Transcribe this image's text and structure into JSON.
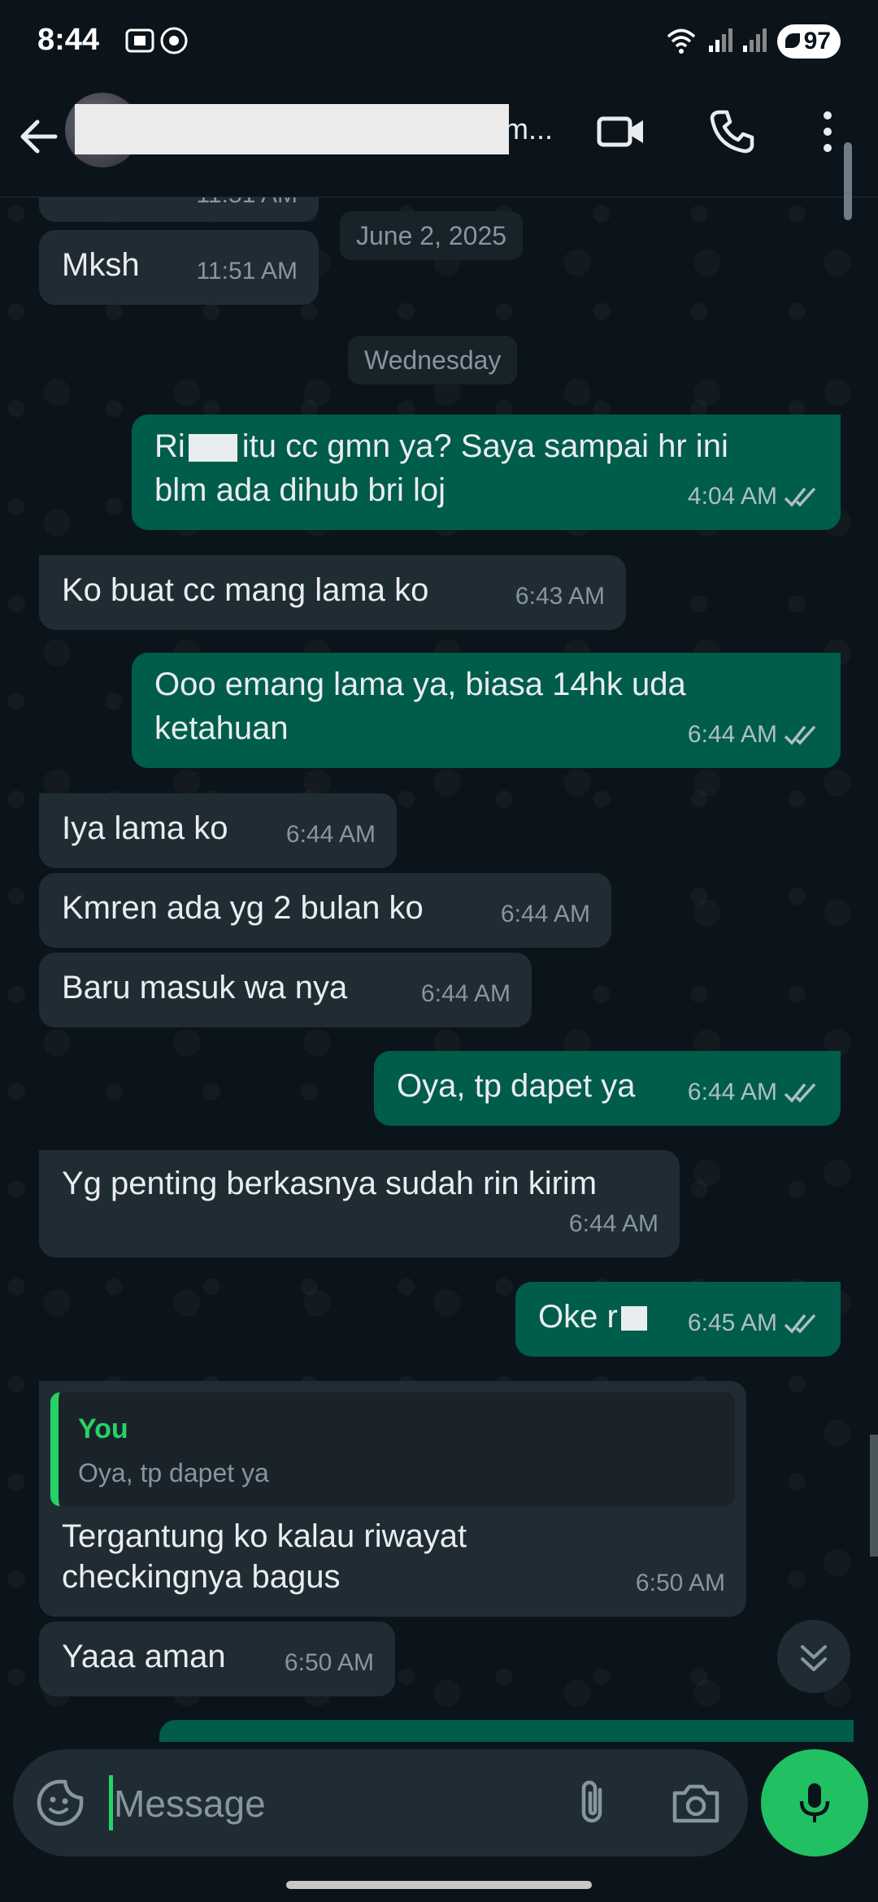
{
  "status_bar": {
    "time": "8:44",
    "battery": "97"
  },
  "header": {
    "contact_name_visible": "m..."
  },
  "chat": {
    "top_partial_time": "11:51 AM",
    "date_separator_1": "June 2, 2025",
    "date_separator_2": "Wednesday",
    "messages": [
      {
        "dir": "in",
        "lines": [
          "Mksh"
        ],
        "time": "11:51 AM"
      },
      {
        "dir": "out",
        "lines": [
          "Ri",
          "itu cc gmn ya? Saya sampai hr ini",
          "blm ada dihub bri loj"
        ],
        "time": "4:04 AM"
      },
      {
        "dir": "in",
        "lines": [
          "Ko buat cc mang lama ko"
        ],
        "time": "6:43 AM"
      },
      {
        "dir": "out",
        "lines": [
          "Ooo emang lama ya, biasa 14hk uda",
          "ketahuan"
        ],
        "time": "6:44 AM"
      },
      {
        "dir": "in",
        "lines": [
          "Iya lama ko"
        ],
        "time": "6:44 AM"
      },
      {
        "dir": "in",
        "lines": [
          "Kmren ada yg 2 bulan ko"
        ],
        "time": "6:44 AM"
      },
      {
        "dir": "in",
        "lines": [
          "Baru masuk wa nya"
        ],
        "time": "6:44 AM"
      },
      {
        "dir": "out",
        "lines": [
          "Oya, tp dapet ya"
        ],
        "time": "6:44 AM"
      },
      {
        "dir": "in",
        "lines": [
          "Yg penting berkasnya sudah rin kirim"
        ],
        "time": "6:44 AM"
      },
      {
        "dir": "out",
        "lines": [
          "Oke r"
        ],
        "time": "6:45 AM"
      },
      {
        "dir": "in",
        "quote_name": "You",
        "quote_text": "Oya, tp dapet ya",
        "lines": [
          "Tergantung ko kalau riwayat",
          "checkingnya bagus"
        ],
        "time": "6:50 AM"
      },
      {
        "dir": "in",
        "lines": [
          "Yaaa aman"
        ],
        "time": "6:50 AM"
      }
    ]
  },
  "input": {
    "placeholder": "Message"
  },
  "colors": {
    "accent": "#25d366",
    "outgoing": "#005c4b",
    "incoming": "#202c33",
    "background": "#0b141a"
  }
}
